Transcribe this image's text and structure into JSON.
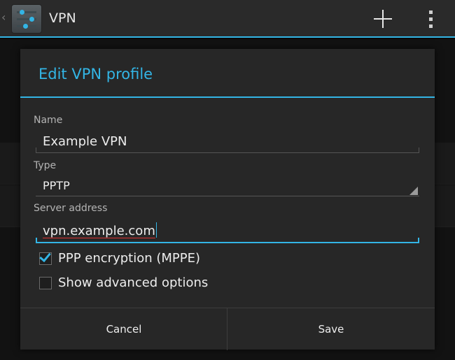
{
  "action_bar": {
    "title": "VPN",
    "up_icon": "chevron-left-icon",
    "app_icon": "vpn-settings-icon",
    "actions": [
      {
        "icon": "add-icon"
      },
      {
        "icon": "overflow-menu-icon"
      }
    ]
  },
  "dialog": {
    "title": "Edit VPN profile",
    "name": {
      "label": "Name",
      "value": "Example VPN"
    },
    "type": {
      "label": "Type",
      "selected": "PPTP"
    },
    "server": {
      "label": "Server address",
      "value": "vpn.example.com"
    },
    "encryption": {
      "label": "PPP encryption (MPPE)",
      "checked": true
    },
    "advanced": {
      "label": "Show advanced options",
      "checked": false
    },
    "buttons": {
      "cancel": "Cancel",
      "save": "Save"
    }
  },
  "colors": {
    "accent": "#33b5e5",
    "dialog_bg": "#272727",
    "text": "#ededed",
    "label": "#b4b4b4",
    "spellcheck": "#dd3333"
  }
}
